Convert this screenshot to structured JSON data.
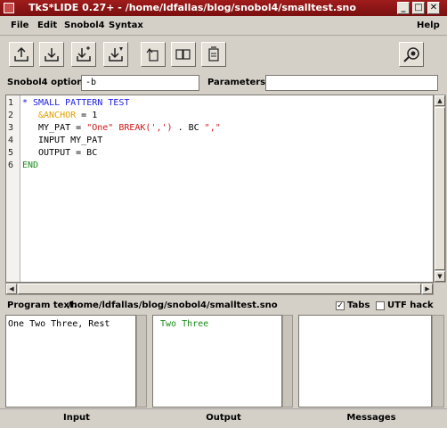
{
  "window": {
    "title": "TkS*LIDE 0.27+ - /home/ldfallas/blog/snobol4/smalltest.sno",
    "minimize": "_",
    "maximize": "□",
    "close": "✕"
  },
  "menubar": {
    "file": "File",
    "edit": "Edit",
    "snobol4": "Snobol4",
    "syntax": "Syntax",
    "help": "Help"
  },
  "toolbar": {
    "buttons": [
      "open-file-icon",
      "save-file-icon",
      "save-as-icon",
      "run-icon",
      "copy-icon",
      "book-icon",
      "document-icon",
      "settings-icon"
    ]
  },
  "options": {
    "snobol4_label": "Snobol4 options:",
    "snobol4_value": "-b",
    "parameters_label": "Parameters:",
    "parameters_value": ""
  },
  "editor": {
    "line_numbers": [
      "1",
      "2",
      "3",
      "4",
      "5",
      "6"
    ],
    "lines": [
      "* SMALL PATTERN TEST",
      "&ANCHOR = 1",
      "MY_PAT = \"One\" BREAK(',') . BC \",\"",
      "INPUT MY_PAT",
      "OUTPUT = BC",
      "END"
    ]
  },
  "program": {
    "label": "Program text:",
    "path": "/home/ldfallas/blog/snobol4/smalltest.sno",
    "tabs_label": "Tabs",
    "tabs_checked": "✓",
    "utf_label": "UTF hack"
  },
  "panes": {
    "input_text": "One Two Three, Rest",
    "output_text": "Two Three",
    "messages_text": "",
    "input_label": "Input",
    "output_label": "Output",
    "messages_label": "Messages"
  }
}
